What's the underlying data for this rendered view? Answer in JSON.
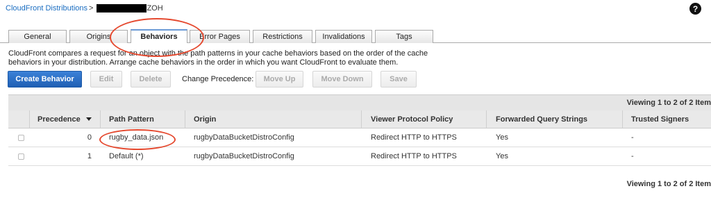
{
  "breadcrumb": {
    "link": "CloudFront Distributions",
    "separator": ">",
    "suffix": "ZOH"
  },
  "help_icon": "?",
  "tabs": [
    {
      "label": "General",
      "active": false
    },
    {
      "label": "Origins",
      "active": false
    },
    {
      "label": "Behaviors",
      "active": true
    },
    {
      "label": "Error Pages",
      "active": false
    },
    {
      "label": "Restrictions",
      "active": false
    },
    {
      "label": "Invalidations",
      "active": false
    },
    {
      "label": "Tags",
      "active": false
    }
  ],
  "description": "CloudFront compares a request for an object with the path patterns in your cache behaviors based on the order of the cache behaviors in your distribution. Arrange cache behaviors in the order in which you want CloudFront to evaluate them.",
  "toolbar": {
    "create": "Create Behavior",
    "edit": "Edit",
    "delete": "Delete",
    "change_precedence_label": "Change Precedence:",
    "move_up": "Move Up",
    "move_down": "Move Down",
    "save": "Save"
  },
  "grid": {
    "viewing_top": "Viewing 1 to 2 of 2 Item",
    "viewing_bottom": "Viewing 1 to 2 of 2 Item",
    "columns": [
      "Precedence",
      "Path Pattern",
      "Origin",
      "Viewer Protocol Policy",
      "Forwarded Query Strings",
      "Trusted Signers"
    ],
    "rows": [
      {
        "precedence": "0",
        "path": "rugby_data.json",
        "origin": "rugbyDataBucketDistroConfig",
        "viewer_policy": "Redirect HTTP to HTTPS",
        "forwarded": "Yes",
        "signers": "-"
      },
      {
        "precedence": "1",
        "path": "Default (*)",
        "origin": "rugbyDataBucketDistroConfig",
        "viewer_policy": "Redirect HTTP to HTTPS",
        "forwarded": "Yes",
        "signers": "-"
      }
    ]
  },
  "colors": {
    "link": "#1a6dc1",
    "primary_button": "#1f5fb4",
    "annotation": "#e5492f"
  }
}
